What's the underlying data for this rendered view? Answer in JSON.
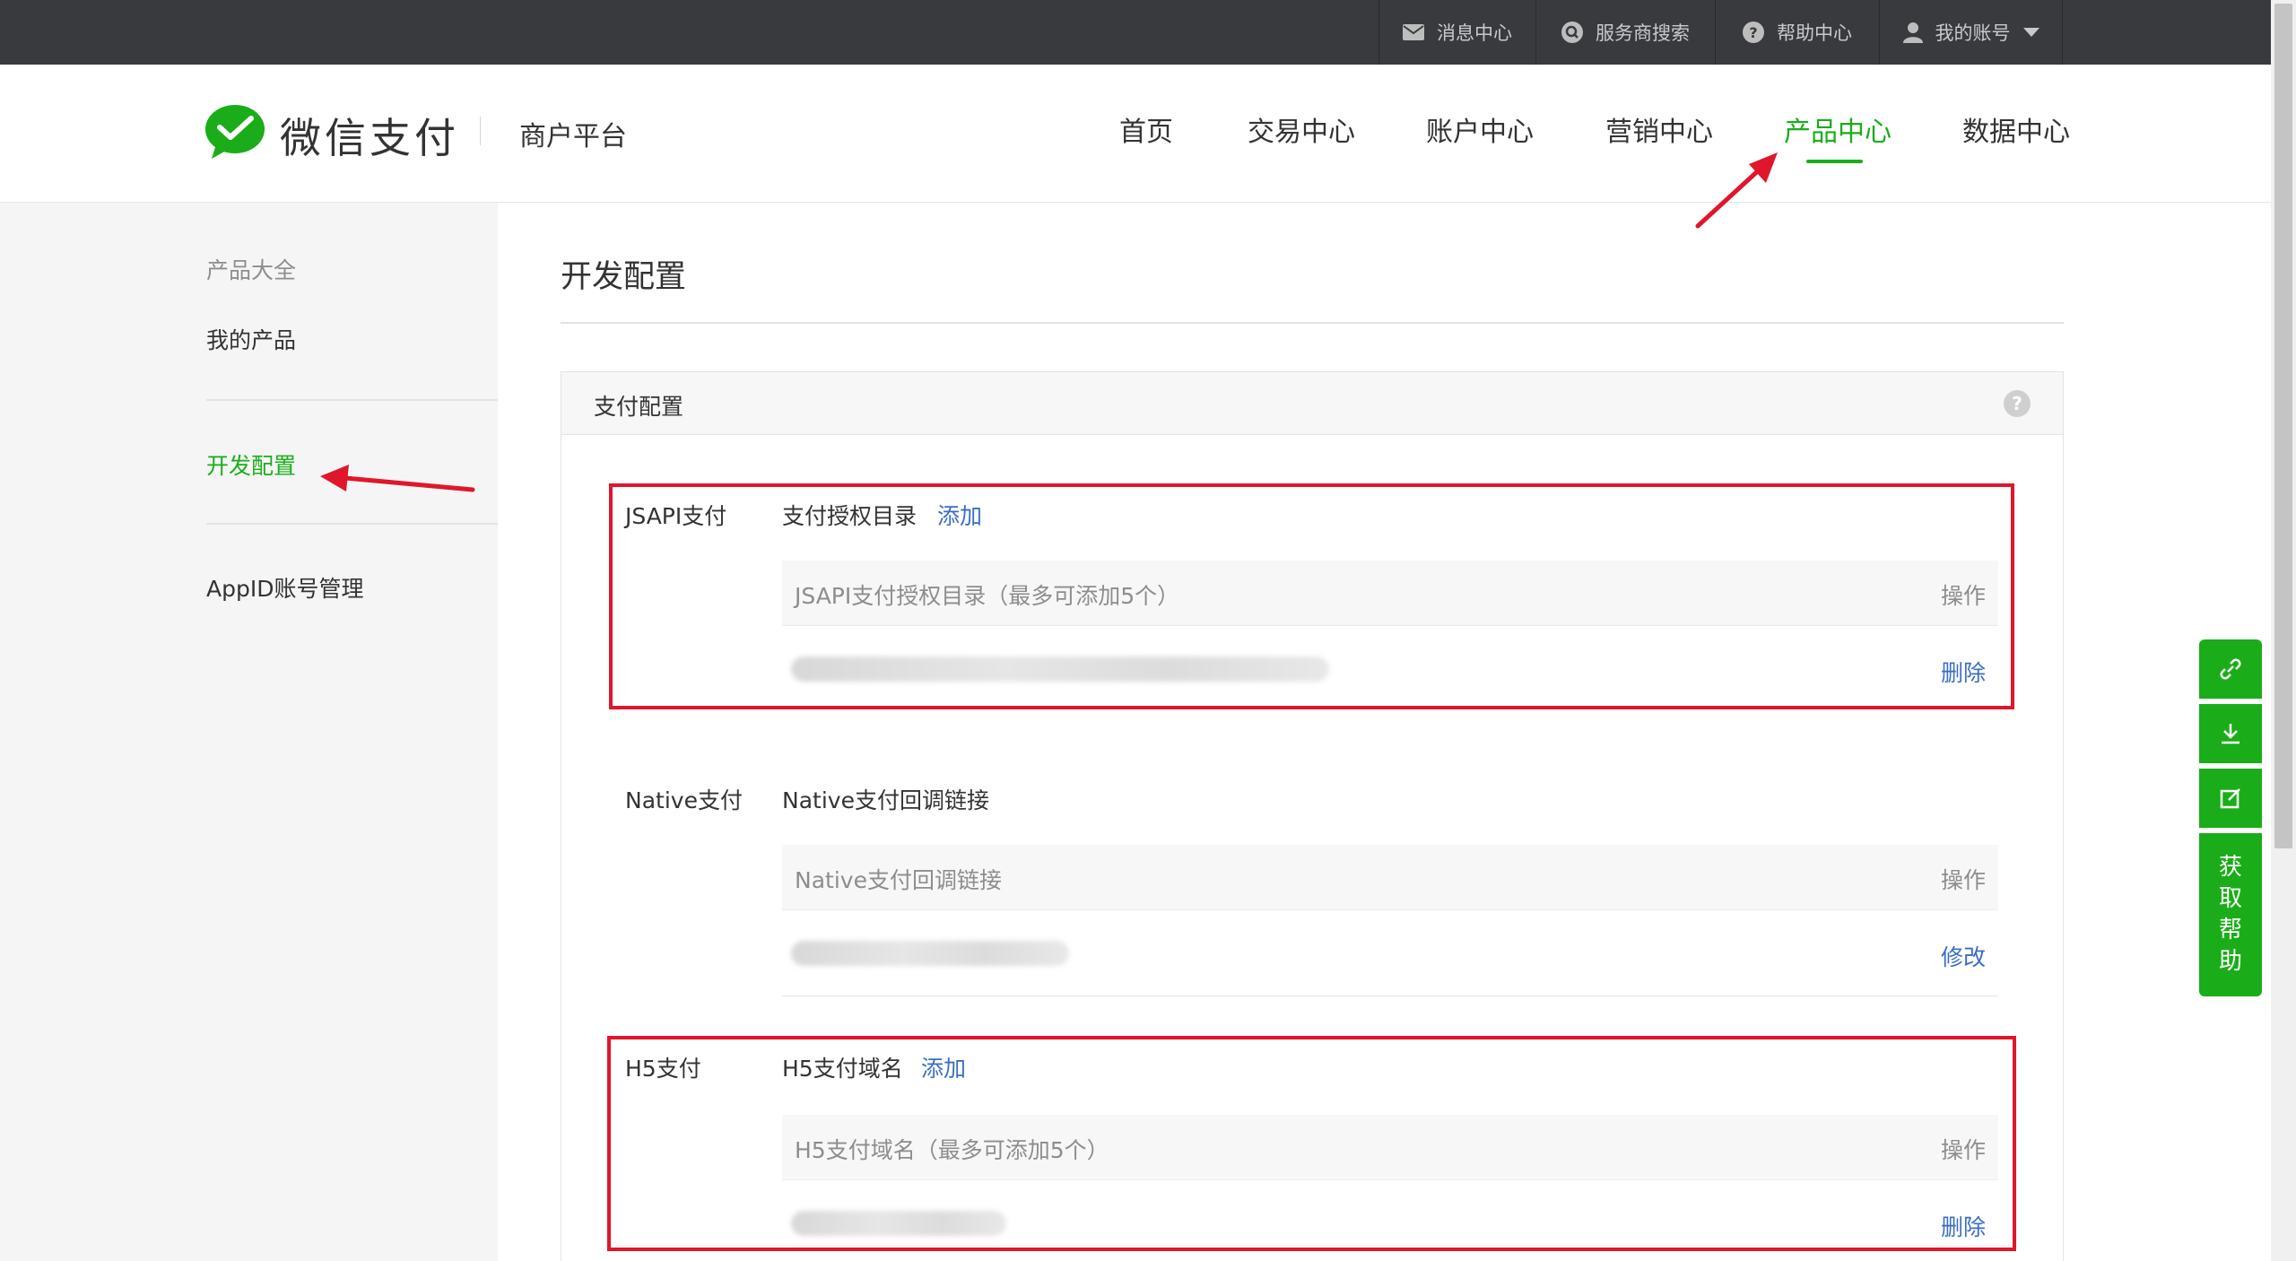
{
  "topbar": {
    "messages": "消息中心",
    "provider_search": "服务商搜索",
    "help": "帮助中心",
    "account": "我的账号"
  },
  "header": {
    "logo_text": "微信支付",
    "platform": "商户平台",
    "nav": [
      "首页",
      "交易中心",
      "账户中心",
      "营销中心",
      "产品中心",
      "数据中心"
    ],
    "active_nav": "产品中心"
  },
  "sidebar": {
    "items": [
      "产品大全",
      "我的产品",
      "开发配置",
      "AppID账号管理"
    ],
    "active": "开发配置"
  },
  "main": {
    "title": "开发配置",
    "panel_title": "支付配置",
    "help_glyph": "?",
    "sections": [
      {
        "label": "JSAPI支付",
        "sub": "支付授权目录",
        "add_link": "添加",
        "table_header": "JSAPI支付授权目录（最多可添加5个）",
        "op_header": "操作",
        "row_action": "删除"
      },
      {
        "label": "Native支付",
        "sub": "Native支付回调链接",
        "table_header": "Native支付回调链接",
        "op_header": "操作",
        "row_action": "修改"
      },
      {
        "label": "H5支付",
        "sub": "H5支付域名",
        "add_link": "添加",
        "table_header": "H5支付域名（最多可添加5个）",
        "op_header": "操作",
        "row_action": "删除"
      }
    ]
  },
  "help_widget": {
    "chars": [
      "获",
      "取",
      "帮",
      "助"
    ]
  },
  "colors": {
    "brand_green": "#1aad19",
    "link_blue": "#3a6dc6",
    "annotation_red": "#e0162b",
    "topbar_bg": "#393a3e"
  }
}
